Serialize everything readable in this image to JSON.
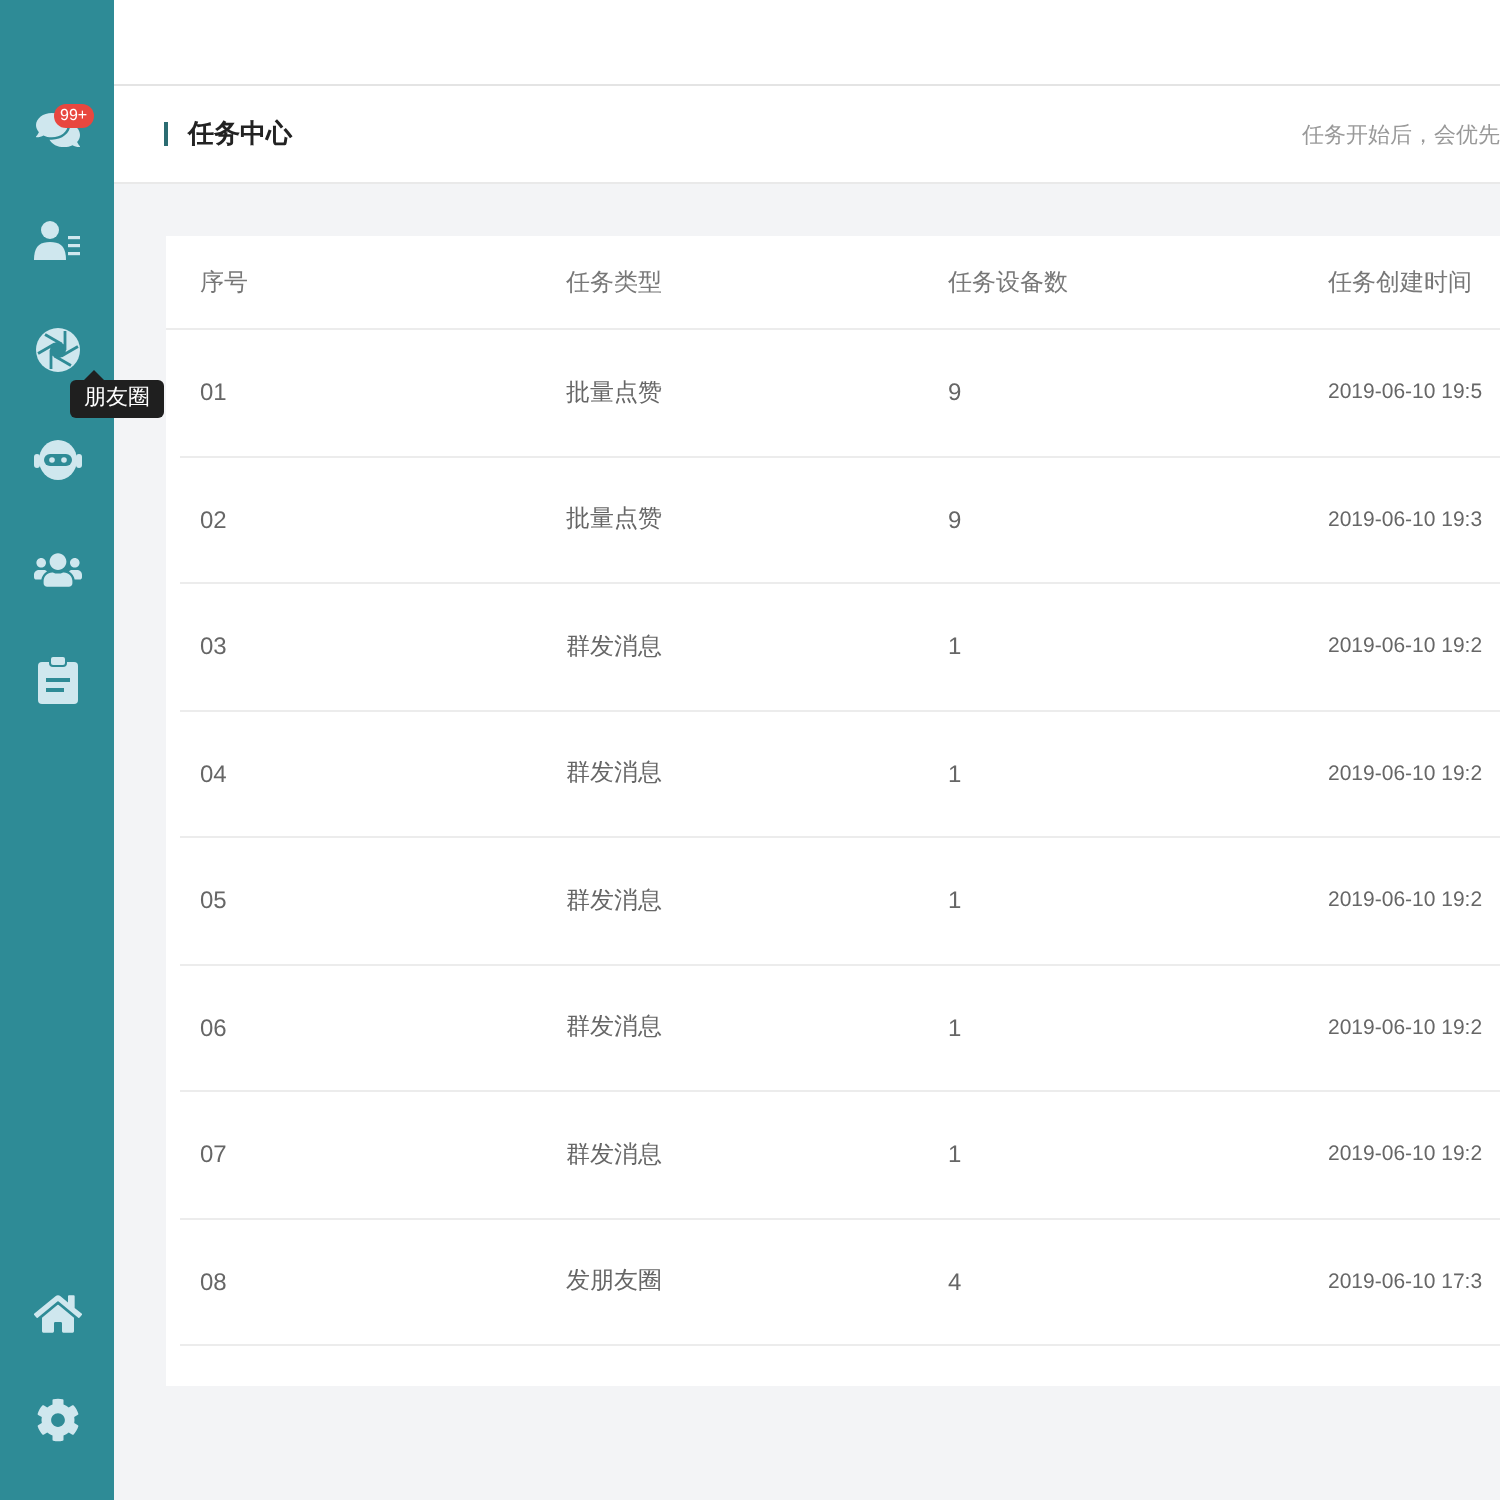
{
  "sidebar": {
    "badge": "99+",
    "tooltip": "朋友圈"
  },
  "header": {
    "title": "任务中心",
    "hint": "任务开始后，会优先"
  },
  "table": {
    "columns": [
      "序号",
      "任务类型",
      "任务设备数",
      "任务创建时间"
    ],
    "rows": [
      [
        "01",
        "批量点赞",
        "9",
        "2019-06-10 19:5"
      ],
      [
        "02",
        "批量点赞",
        "9",
        "2019-06-10 19:3"
      ],
      [
        "03",
        "群发消息",
        "1",
        "2019-06-10 19:2"
      ],
      [
        "04",
        "群发消息",
        "1",
        "2019-06-10 19:2"
      ],
      [
        "05",
        "群发消息",
        "1",
        "2019-06-10 19:2"
      ],
      [
        "06",
        "群发消息",
        "1",
        "2019-06-10 19:2"
      ],
      [
        "07",
        "群发消息",
        "1",
        "2019-06-10 19:2"
      ],
      [
        "08",
        "发朋友圈",
        "4",
        "2019-06-10 17:3"
      ]
    ]
  }
}
